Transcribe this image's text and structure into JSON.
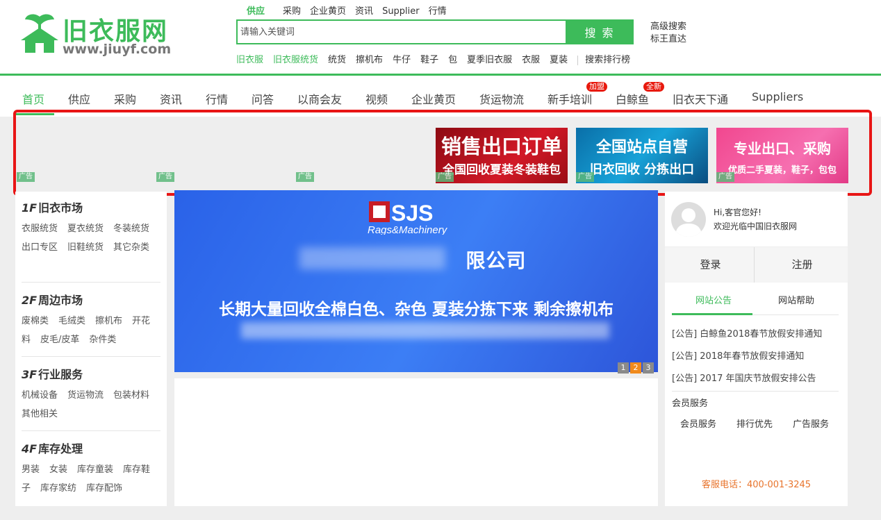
{
  "logo": {
    "name": "旧衣服网",
    "url": "www.jiuyf.com"
  },
  "search": {
    "tabs": [
      "供应",
      "采购",
      "企业黄页",
      "资讯",
      "Supplier",
      "行情"
    ],
    "active_tab": "供应",
    "placeholder": "请输入关键词",
    "value": "",
    "button": "搜 索",
    "advanced": "高级搜索",
    "bid": "标王直达",
    "hot": [
      "旧衣服",
      "旧衣服统货",
      "统货",
      "擦机布",
      "牛仔",
      "鞋子",
      "包",
      "夏季旧衣服",
      "衣服",
      "夏装"
    ],
    "ranking": "搜索排行榜"
  },
  "nav": {
    "items": [
      "首页",
      "供应",
      "采购",
      "资讯",
      "行情",
      "问答",
      "以商会友",
      "视频",
      "企业黄页",
      "货运物流",
      "新手培训",
      "白鲸鱼",
      "旧衣天下通",
      "Suppliers"
    ],
    "active": "首页",
    "badge_join": "加盟",
    "badge_new": "全新"
  },
  "ads": {
    "tag": "广告",
    "red": {
      "line1": "销售出口订单",
      "line2": "全国回收夏装冬装鞋包"
    },
    "blue": {
      "line1": "全国站点自营",
      "line2": "旧衣回收  分拣出口"
    },
    "pink": {
      "line1": "专业出口、采购",
      "line2": "优质二手夏装，鞋子，包包"
    }
  },
  "categories": [
    {
      "floor": "1F",
      "title": "旧衣市场",
      "links": [
        "衣服统货",
        "夏衣统货",
        "冬装统货",
        "出口专区",
        "旧鞋统货",
        "其它杂类"
      ]
    },
    {
      "floor": "2F",
      "title": "周边市场",
      "links": [
        "废棉类",
        "毛绒类",
        "擦机布",
        "开花料",
        "皮毛/皮革",
        "杂件类"
      ]
    },
    {
      "floor": "3F",
      "title": "行业服务",
      "links": [
        "机械设备",
        "货运物流",
        "包装材料",
        "其他相关"
      ]
    },
    {
      "floor": "4F",
      "title": "库存处理",
      "links": [
        "男装",
        "女装",
        "库存童装",
        "库存鞋子",
        "库存家纺",
        "库存配饰"
      ]
    }
  ],
  "banner": {
    "brand": "SJS",
    "brand_sub": "Rags&Machinery",
    "company_suffix": "限公司",
    "slogan": "长期大量回收全棉白色、杂色 夏装分拣下来 剩余擦机布",
    "pages": [
      "1",
      "2",
      "3"
    ],
    "current_page": "2"
  },
  "user": {
    "greeting": "Hi,客官您好!",
    "welcome": "欢迎光临中国旧衣服网",
    "login": "登录",
    "register": "注册"
  },
  "notices": {
    "tabs": [
      "网站公告",
      "网站帮助"
    ],
    "items": [
      "[公告] 白鲸鱼2018春节放假安排通知",
      "[公告] 2018年春节放假安排通知",
      "[公告] 2017 年国庆节放假安排公告"
    ]
  },
  "member": {
    "title": "会员服务",
    "links": [
      "会员服务",
      "排行优先",
      "广告服务"
    ]
  },
  "hotline": "客服电话：400-001-3245",
  "colors": {
    "brand_green": "#3dbb5a",
    "highlight_red": "#e81515",
    "banner_blue": "#3c7ef5",
    "hotline_orange": "#e8742c"
  }
}
